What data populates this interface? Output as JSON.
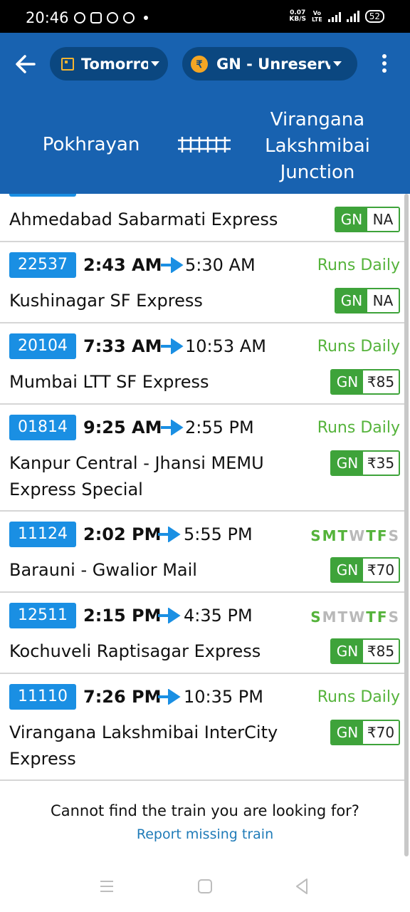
{
  "status_bar": {
    "time": "20:46",
    "net_speed": "0.07",
    "net_unit": "KB/S",
    "network_label": "VoLTE",
    "battery": "52"
  },
  "app_bar": {
    "date_filter": "Tomorrow",
    "class_filter": "GN - Unreserved",
    "accent": "#1862b0",
    "pill_color": "#0b4780"
  },
  "route": {
    "from": "Pokhrayan",
    "to_lines": [
      "Virangana",
      "Lakshmibai",
      "Junction"
    ]
  },
  "trains": [
    {
      "number": "",
      "name": "Ahmedabad Sabarmati Express",
      "class": "GN",
      "fare": "NA"
    },
    {
      "number": "22537",
      "dep": "2:43 AM",
      "arr": "5:30 AM",
      "runs": "Runs Daily",
      "name": "Kushinagar SF Express",
      "class": "GN",
      "fare": "NA"
    },
    {
      "number": "20104",
      "dep": "7:33 AM",
      "arr": "10:53 AM",
      "runs": "Runs Daily",
      "name": "Mumbai LTT SF Express",
      "class": "GN",
      "fare": "₹85"
    },
    {
      "number": "01814",
      "dep": "9:25 AM",
      "arr": "2:55 PM",
      "runs": "Runs Daily",
      "name": "Kanpur Central - Jhansi MEMU Express Special",
      "class": "GN",
      "fare": "₹35"
    },
    {
      "number": "11124",
      "dep": "2:02 PM",
      "arr": "5:55 PM",
      "days": [
        "S",
        "M",
        "T",
        "W",
        "T",
        "F",
        "S"
      ],
      "days_on": [
        true,
        true,
        true,
        false,
        true,
        true,
        false
      ],
      "name": "Barauni - Gwalior Mail",
      "class": "GN",
      "fare": "₹70"
    },
    {
      "number": "12511",
      "dep": "2:15 PM",
      "arr": "4:35 PM",
      "days": [
        "S",
        "M",
        "T",
        "W",
        "T",
        "F",
        "S"
      ],
      "days_on": [
        true,
        false,
        false,
        false,
        true,
        true,
        false
      ],
      "name": "Kochuveli Raptisagar Express",
      "class": "GN",
      "fare": "₹85"
    },
    {
      "number": "11110",
      "dep": "7:26 PM",
      "arr": "10:35 PM",
      "runs": "Runs Daily",
      "name": "Virangana Lakshmibai InterCity Express",
      "class": "GN",
      "fare": "₹70"
    }
  ],
  "footer": {
    "question": "Cannot find the train you are looking for?",
    "link": "Report missing train"
  },
  "colors": {
    "badge": "#1a8fe3",
    "runs_green": "#55b33b",
    "fare_green": "#3ea33a",
    "day_off": "#b9b9b9",
    "link": "#1f7bb8"
  }
}
